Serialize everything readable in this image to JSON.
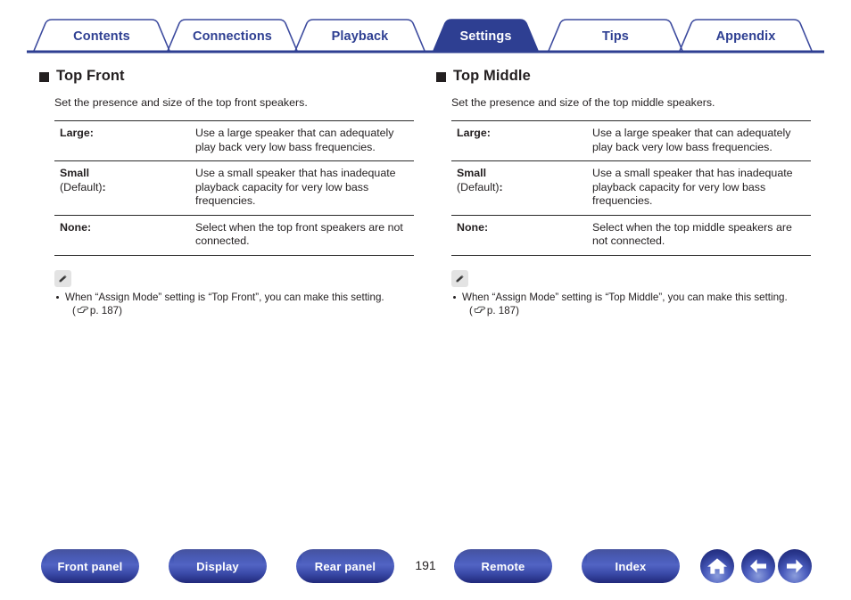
{
  "tabs": [
    {
      "label": "Contents",
      "active": false
    },
    {
      "label": "Connections",
      "active": false
    },
    {
      "label": "Playback",
      "active": false
    },
    {
      "label": "Settings",
      "active": true
    },
    {
      "label": "Tips",
      "active": false
    },
    {
      "label": "Appendix",
      "active": false
    }
  ],
  "colors": {
    "navy": "#2e3f92",
    "tab_active_bg": "#2e3f92",
    "tab_active_text": "#ffffff",
    "text": "#231f20",
    "rule": "#2b2b2b",
    "note_icon_bg": "#e3e3e3"
  },
  "sections": [
    {
      "title": "Top Front",
      "description": "Set the presence and size of the top front speakers.",
      "rows": [
        {
          "term": "Large",
          "term_suffix": ":",
          "default": false,
          "description": "Use a large speaker that can adequately play back very low bass frequencies."
        },
        {
          "term": "Small",
          "term_suffix": "",
          "default": true,
          "default_label": "(Default)",
          "default_colon": ":",
          "description": "Use a small speaker that has inadequate playback capacity for very low bass frequencies."
        },
        {
          "term": "None",
          "term_suffix": ":",
          "default": false,
          "description": "Select when the top front speakers are not connected."
        }
      ],
      "note": {
        "icon": "pencil-icon",
        "bullet_text": "When “Assign Mode” setting is “Top Front”, you can make this setting.",
        "ref_open": "(",
        "ref_icon": "pointing-hand-icon",
        "ref_text": "p. 187",
        "ref_close": ")"
      }
    },
    {
      "title": "Top Middle",
      "description": "Set the presence and size of the top middle speakers.",
      "rows": [
        {
          "term": "Large",
          "term_suffix": ":",
          "default": false,
          "description": "Use a large speaker that can adequately play back very low bass frequencies."
        },
        {
          "term": "Small",
          "term_suffix": "",
          "default": true,
          "default_label": "(Default)",
          "default_colon": ":",
          "description": "Use a small speaker that has inadequate playback capacity for very low bass frequencies."
        },
        {
          "term": "None",
          "term_suffix": ":",
          "default": false,
          "description": "Select when the top middle speakers are not connected."
        }
      ],
      "note": {
        "icon": "pencil-icon",
        "bullet_text": "When “Assign Mode” setting is “Top Middle”, you can make this setting.",
        "ref_open": "(",
        "ref_icon": "pointing-hand-icon",
        "ref_text": "p. 187",
        "ref_close": ")"
      }
    }
  ],
  "footer": {
    "buttons": [
      {
        "label": "Front panel"
      },
      {
        "label": "Display"
      },
      {
        "label": "Rear panel"
      },
      {
        "label": "Remote"
      },
      {
        "label": "Index"
      }
    ],
    "page_number": "191",
    "icon_buttons": [
      {
        "name": "home-icon"
      },
      {
        "name": "back-arrow-icon"
      },
      {
        "name": "forward-arrow-icon"
      }
    ]
  }
}
